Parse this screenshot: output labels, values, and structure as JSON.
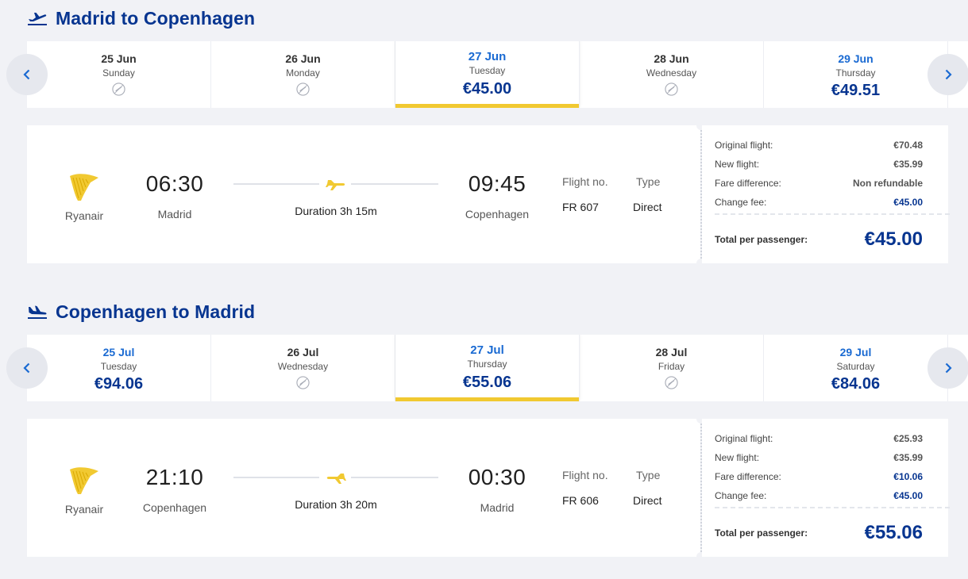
{
  "outbound": {
    "title": "Madrid to Copenhagen",
    "dates": [
      {
        "day": "25 Jun",
        "weekday": "Sunday",
        "price": null,
        "state": "dis"
      },
      {
        "day": "26 Jun",
        "weekday": "Monday",
        "price": null,
        "state": "dis"
      },
      {
        "day": "27 Jun",
        "weekday": "Tuesday",
        "price": "€45.00",
        "state": "sel"
      },
      {
        "day": "28 Jun",
        "weekday": "Wednesday",
        "price": null,
        "state": "dis"
      },
      {
        "day": "29 Jun",
        "weekday": "Thursday",
        "price": "€49.51",
        "state": "avail"
      }
    ],
    "flight": {
      "airline": "Ryanair",
      "dep_time": "06:30",
      "dep_city": "Madrid",
      "duration": "Duration 3h 15m",
      "arr_time": "09:45",
      "arr_city": "Copenhagen",
      "flight_no_label": "Flight no.",
      "flight_no": "FR 607",
      "type_label": "Type",
      "type": "Direct"
    },
    "summary": {
      "original_label": "Original flight:",
      "original": "€70.48",
      "new_label": "New flight:",
      "new": "€35.99",
      "fare_label": "Fare difference:",
      "fare": "Non refundable",
      "change_label": "Change fee:",
      "change": "€45.00",
      "total_label": "Total per passenger:",
      "total": "€45.00"
    }
  },
  "return": {
    "title": "Copenhagen to Madrid",
    "dates": [
      {
        "day": "25 Jul",
        "weekday": "Tuesday",
        "price": "€94.06",
        "state": "avail"
      },
      {
        "day": "26 Jul",
        "weekday": "Wednesday",
        "price": null,
        "state": "dis"
      },
      {
        "day": "27 Jul",
        "weekday": "Thursday",
        "price": "€55.06",
        "state": "sel"
      },
      {
        "day": "28 Jul",
        "weekday": "Friday",
        "price": null,
        "state": "dis"
      },
      {
        "day": "29 Jul",
        "weekday": "Saturday",
        "price": "€84.06",
        "state": "avail"
      }
    ],
    "flight": {
      "airline": "Ryanair",
      "dep_time": "21:10",
      "dep_city": "Copenhagen",
      "duration": "Duration 3h 20m",
      "arr_time": "00:30",
      "arr_city": "Madrid",
      "flight_no_label": "Flight no.",
      "flight_no": "FR 606",
      "type_label": "Type",
      "type": "Direct"
    },
    "summary": {
      "original_label": "Original flight:",
      "original": "€25.93",
      "new_label": "New flight:",
      "new": "€35.99",
      "fare_label": "Fare difference:",
      "fare": "€10.06",
      "change_label": "Change fee:",
      "change": "€45.00",
      "total_label": "Total per passenger:",
      "total": "€55.06"
    }
  },
  "colors": {
    "brand_blue": "#073590",
    "link_blue": "#1a6ad2",
    "accent_yellow": "#f1c931",
    "background": "#f1f2f6"
  },
  "icons": {
    "departure": "plane-takeoff-icon",
    "arrival": "plane-landing-icon",
    "no_flights": "no-flights-icon",
    "airline_logo": "ryanair-harp-logo"
  }
}
